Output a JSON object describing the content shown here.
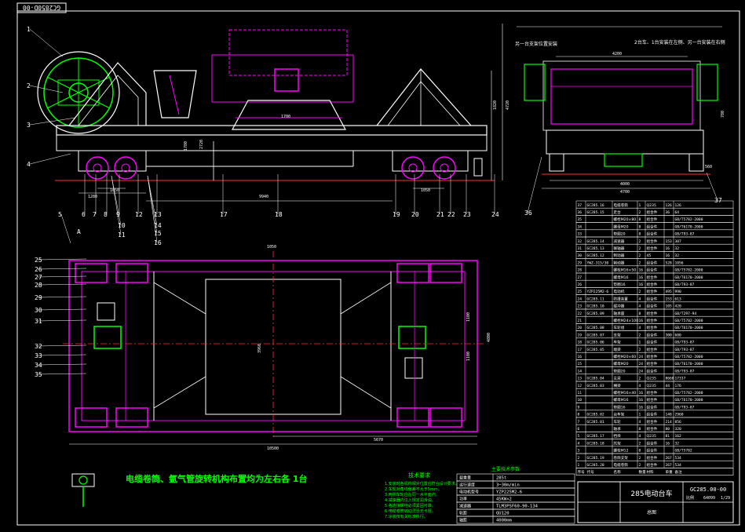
{
  "drawing_no": "GC2850D-00",
  "colors": {
    "bg": "#000000",
    "border": "#ffffff",
    "magenta": "#ff00ff",
    "green": "#00ff00",
    "cyan": "#00ffff",
    "yellow": "#ffff00",
    "white": "#ffffff",
    "red": "#ff3030"
  },
  "callouts_left": [
    "1",
    "2",
    "3",
    "4"
  ],
  "callouts_bottom_row1": [
    "6",
    "7",
    "8",
    "9",
    "12",
    "13",
    "17",
    "18",
    "19",
    "20",
    "21",
    "22",
    "23",
    "24"
  ],
  "callouts_bottom_row2": [
    "10",
    "11",
    "14",
    "15",
    "16"
  ],
  "callouts_plan": [
    "5",
    "25",
    "26",
    "27",
    "28",
    "29",
    "30",
    "31",
    "32",
    "33",
    "34",
    "35"
  ],
  "callout_a": "A",
  "callout_36": "36",
  "callout_37": "37",
  "dims_elev": {
    "d1280": "1280",
    "d1050a": "1050",
    "d9940": "9940",
    "d1050b": "1050",
    "d1700": "1700",
    "d4720": "4720",
    "d1820": "1820",
    "d2720": "2720",
    "d1780": "1780"
  },
  "dims_side": {
    "d4200": "4200",
    "d4000": "4000",
    "d4700": "4700",
    "d780": "780",
    "d560": "560"
  },
  "dims_plan": {
    "d10500": "10500",
    "d5670": "5670",
    "d3960": "3960",
    "d4800": "4800",
    "d1100a": "1100",
    "d1100b": "1100",
    "d1050": "1050"
  },
  "side_notes": {
    "left": "另一台支架位置安装",
    "mid": "2台车、1台安装在左侧、另一台安装在右侧"
  },
  "main_title_cn": "电缆卷筒、氩气管旋转机构布置均为左右各 1台",
  "tech_title": "技术要求",
  "tech_lines": [
    "1.安装时各机构相对位置应符合设计要求。",
    "2.车轮对角线偏差不大于5mm。",
    "3.两侧车轮应在同一水平面内。",
    "4.减速器内注入规定润滑油。",
    "5.各连接螺栓必须紧固可靠。",
    "6.电缆卷筒转动灵活无卡阻。",
    "7.涂装按有关标准执行。"
  ],
  "spec_title": "主要技术参数",
  "spec_rows": [
    [
      "载重量",
      "285t"
    ],
    [
      "运行速度",
      "3~30m/min"
    ],
    [
      "电动机型号",
      "YZP225M2-6"
    ],
    [
      "功率",
      "45KW×2"
    ],
    [
      "减速器",
      "TLM3PSF60-90-134"
    ],
    [
      "轨距",
      "QU120"
    ],
    [
      "轴距",
      "4000mm"
    ]
  ],
  "bom_rows": [
    [
      "37",
      "GC285.16",
      "电缆卷筒",
      "1",
      "Q235",
      "126",
      "126"
    ],
    [
      "36",
      "GC285.15",
      "走台",
      "2",
      "组合件",
      "36",
      "64"
    ],
    [
      "35",
      "",
      "螺栓M20×80",
      "8",
      "组合件",
      "",
      "GB/T5782-2000"
    ],
    [
      "34",
      "",
      "螺母M20",
      "8",
      "组合件",
      "",
      "GB/T6170-2000"
    ],
    [
      "33",
      "",
      "垫圈20",
      "8",
      "组合件",
      "",
      "GB/T93-87"
    ],
    [
      "32",
      "GC285.14",
      "减速器",
      "2",
      "组合件",
      "153",
      "307"
    ],
    [
      "31",
      "GC285.13",
      "联轴器",
      "2",
      "组合件",
      "16",
      "32"
    ],
    [
      "30",
      "GC285.12",
      "制动器",
      "2",
      "45",
      "16",
      "32"
    ],
    [
      "29",
      "YWZ-315/30",
      "制动器",
      "2",
      "组合件",
      "528",
      "1056"
    ],
    [
      "28",
      "",
      "螺栓M16×50",
      "16",
      "组合件",
      "",
      "GB/T5782-2000"
    ],
    [
      "27",
      "",
      "螺母M16",
      "16",
      "组合件",
      "",
      "GB/T6170-2000"
    ],
    [
      "26",
      "",
      "垫圈16",
      "16",
      "组合件",
      "",
      "GB/T93-87"
    ],
    [
      "25",
      "YZP225M2-6",
      "电动机",
      "2",
      "组合件",
      "495",
      "990"
    ],
    [
      "24",
      "GC285.11",
      "防撞装置",
      "4",
      "组合件",
      "153",
      "613"
    ],
    [
      "23",
      "GC285.10",
      "缓冲器",
      "4",
      "组合件",
      "105",
      "420"
    ],
    [
      "22",
      "GC285.09",
      "轴承座",
      "8",
      "组合件",
      "",
      "GB/T297-94"
    ],
    [
      "21",
      "",
      "螺栓M24×100",
      "16",
      "组合件",
      "",
      "GB/T5782-2000"
    ],
    [
      "20",
      "GC285.08",
      "车轮组",
      "4",
      "组合件",
      "",
      "GB/T6170-2000"
    ],
    [
      "19",
      "GC285.07",
      "支架",
      "2",
      "组合件",
      "300",
      "600"
    ],
    [
      "18",
      "GC285.06",
      "车架",
      "1",
      "组合件",
      "",
      "GB/T93-87"
    ],
    [
      "17",
      "GC285.05",
      "端梁",
      "2",
      "组合件",
      "",
      "GB/T93-87"
    ],
    [
      "16",
      "",
      "螺栓M20×60",
      "24",
      "组合件",
      "",
      "GB/T5782-2000"
    ],
    [
      "15",
      "",
      "螺母M20",
      "24",
      "组合件",
      "",
      "GB/T6170-2000"
    ],
    [
      "14",
      "",
      "垫圈20",
      "24",
      "组合件",
      "",
      "GB/T93-87"
    ],
    [
      "13",
      "GC285.04",
      "主梁",
      "2",
      "Q235",
      "8668",
      "17337"
    ],
    [
      "12",
      "GC285.03",
      "横梁",
      "4",
      "Q235",
      "44",
      "176"
    ],
    [
      "11",
      "",
      "螺栓M16×40",
      "16",
      "组合件",
      "",
      "GB/T5782-2000"
    ],
    [
      "10",
      "",
      "螺母M16",
      "16",
      "组合件",
      "",
      "GB/T6170-2000"
    ],
    [
      "9",
      "",
      "垫圈16",
      "16",
      "组合件",
      "",
      "GB/T93-87"
    ],
    [
      "8",
      "GC285.02",
      "台车架",
      "1",
      "组合件",
      "148",
      "2960"
    ],
    [
      "7",
      "GC285.01",
      "车轮",
      "4",
      "组合件",
      "214",
      "856"
    ],
    [
      "6",
      "",
      "轴承",
      "8",
      "组合件",
      "80",
      "320"
    ],
    [
      "5",
      "GC285.17",
      "挡块",
      "4",
      "Q235",
      "81",
      "162"
    ],
    [
      "4",
      "GC285.18",
      "托架",
      "2",
      "组合件",
      "16",
      "32"
    ],
    [
      "3",
      "",
      "螺栓M12",
      "8",
      "组合件",
      "",
      "GB/T5782"
    ],
    [
      "2",
      "GC285.19",
      "卷筒支架",
      "2",
      "组合件",
      "267",
      "534"
    ],
    [
      "1",
      "GC285.20",
      "电缆卷筒",
      "2",
      "组合件",
      "267",
      "534"
    ]
  ],
  "bom_header": [
    "序号",
    "代号",
    "名称",
    "数量",
    "材料",
    "单重",
    "备注"
  ],
  "title_block": {
    "name": "285电动台车",
    "code": "GC285.00-00",
    "scale": "比例",
    "weight": "64099",
    "sheet": "1/29",
    "total": "总图"
  }
}
